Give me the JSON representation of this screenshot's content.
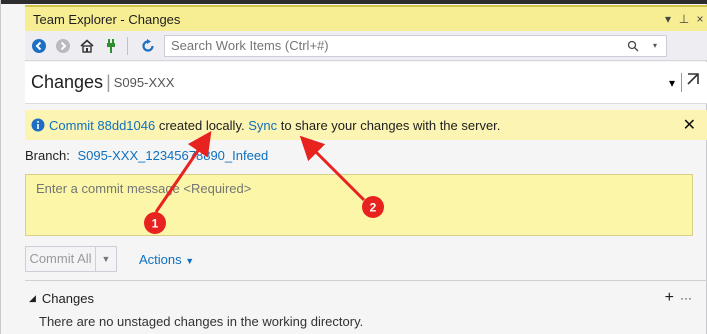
{
  "window": {
    "title": "Team Explorer - Changes",
    "controls": [
      "▾",
      "⊥",
      "×"
    ]
  },
  "toolbar": {
    "search_placeholder": "Search Work Items (Ctrl+#)",
    "icons": [
      "back-icon",
      "forward-icon",
      "home-icon",
      "plug-icon",
      "refresh-icon"
    ]
  },
  "page": {
    "title": "Changes",
    "subtitle": "S095-XXX"
  },
  "info": {
    "prefix": "Commit ",
    "commit_id": "88dd1046",
    "mid": " created locally. ",
    "sync_label": "Sync",
    "suffix": " to share your changes with the server."
  },
  "branch": {
    "label": "Branch:",
    "name": "S095-XXX_12345678890_Infeed"
  },
  "commit": {
    "placeholder": "Enter a commit message <Required>",
    "button_label": "Commit All",
    "actions_label": "Actions"
  },
  "changes": {
    "section_label": "Changes",
    "empty_text": "There are no unstaged changes in the working directory."
  },
  "annotations": [
    {
      "label": "1",
      "color": "#e8231f"
    },
    {
      "label": "2",
      "color": "#e8231f"
    }
  ]
}
